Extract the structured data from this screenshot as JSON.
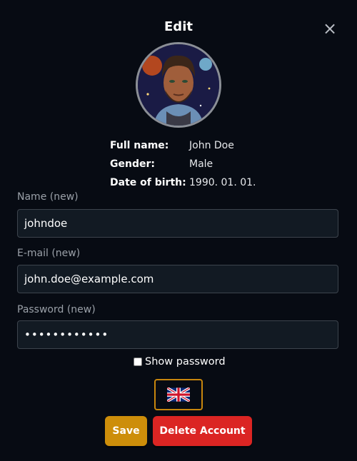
{
  "modal": {
    "title": "Edit",
    "close_symbol": "×"
  },
  "profile": {
    "avatar_icon": "avatar-image",
    "rows": [
      {
        "label": "Full name:",
        "value": "John Doe"
      },
      {
        "label": "Gender:",
        "value": "Male"
      },
      {
        "label": "Date of birth:",
        "value": "1990. 01. 01."
      }
    ]
  },
  "form": {
    "name": {
      "label": "Name (new)",
      "value": "johndoe"
    },
    "email": {
      "label": "E-mail (new)",
      "value": "john.doe@example.com"
    },
    "password": {
      "label": "Password (new)",
      "value": "••••••••••••"
    },
    "show_password_label": "Show password"
  },
  "language": {
    "flag_icon": "uk-flag-icon"
  },
  "buttons": {
    "save": "Save",
    "delete": "Delete Account"
  },
  "colors": {
    "background": "#070b13",
    "save": "#cd8e0a",
    "delete": "#db2523",
    "language_border": "#c8860d"
  }
}
